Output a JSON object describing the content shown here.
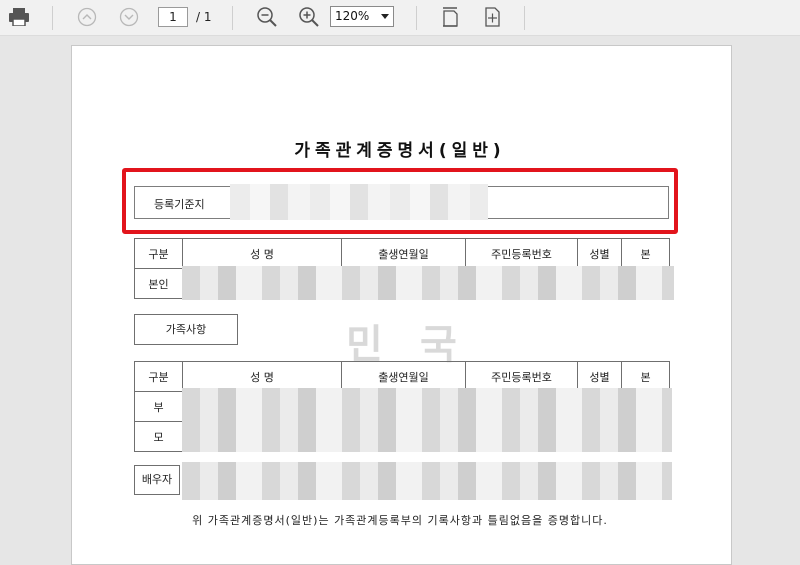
{
  "toolbar": {
    "page_current": "1",
    "page_total": "/ 1",
    "zoom_value": "120%",
    "icons": [
      "printer-icon",
      "page-up-icon",
      "page-down-icon",
      "zoom-out-icon",
      "zoom-in-icon",
      "fit-page-icon",
      "fit-width-icon"
    ]
  },
  "document": {
    "title": "가족관계증명서(일반)",
    "registry_label": "등록기준지",
    "main_table": {
      "headers": [
        "구분",
        "성  명",
        "출생연월일",
        "주민등록번호",
        "성별",
        "본"
      ],
      "rows": [
        [
          "본인"
        ]
      ]
    },
    "family_section_label": "가족사항",
    "family_table": {
      "headers": [
        "구분",
        "성  명",
        "출생연월일",
        "주민등록번호",
        "성별",
        "본"
      ],
      "rows": [
        [
          "부"
        ],
        [
          "모"
        ]
      ]
    },
    "spouse_label": "배우자",
    "watermark": [
      "민",
      "국"
    ],
    "footer": "위 가족관계증명서(일반)는 가족관계등록부의 기록사항과 틀림없음을 증명합니다."
  },
  "colors": {
    "highlight": "#e2141c",
    "toolbar": "#f1f1f1"
  }
}
